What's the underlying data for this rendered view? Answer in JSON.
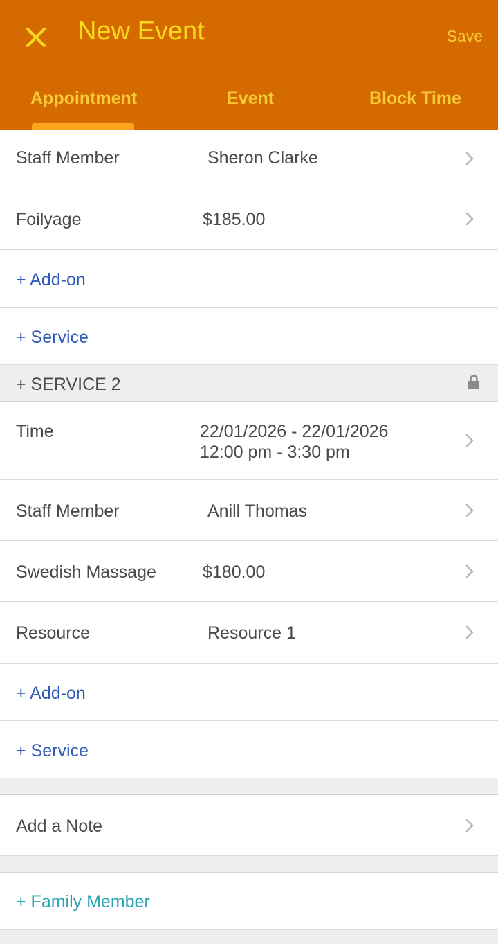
{
  "header": {
    "title": "New Event",
    "save_label": "Save",
    "close_icon": "close-icon",
    "tabs": [
      {
        "label": "Appointment",
        "active": true
      },
      {
        "label": "Event",
        "active": false
      },
      {
        "label": "Block Time",
        "active": false
      }
    ]
  },
  "service1": {
    "staff_label": "Staff Member",
    "staff_value": "Sheron Clarke",
    "service_label": "Foilyage",
    "service_price": "$185.00",
    "addon_link": "+ Add-on",
    "service_link": "+ Service"
  },
  "service2": {
    "section_title": "+ SERVICE 2",
    "time_label": "Time",
    "time_date_range": "22/01/2026 - 22/01/2026",
    "time_range": "12:00 pm - 3:30 pm",
    "staff_label": "Staff Member",
    "staff_value": "Anill Thomas",
    "service_label": "Swedish Massage",
    "service_price": "$180.00",
    "resource_label": "Resource",
    "resource_value": "Resource 1",
    "addon_link": "+ Add-on",
    "service_link": "+ Service"
  },
  "note": {
    "label": "Add a Note"
  },
  "family": {
    "link": "+ Family Member"
  },
  "colors": {
    "header_bg": "#d56a00",
    "title": "#f9d91e",
    "tab_text": "#f7c935",
    "indicator": "#ffa41f",
    "link_blue": "#2f5bb7",
    "link_teal": "#2aa3b5",
    "section_bg": "#eeeeee"
  }
}
